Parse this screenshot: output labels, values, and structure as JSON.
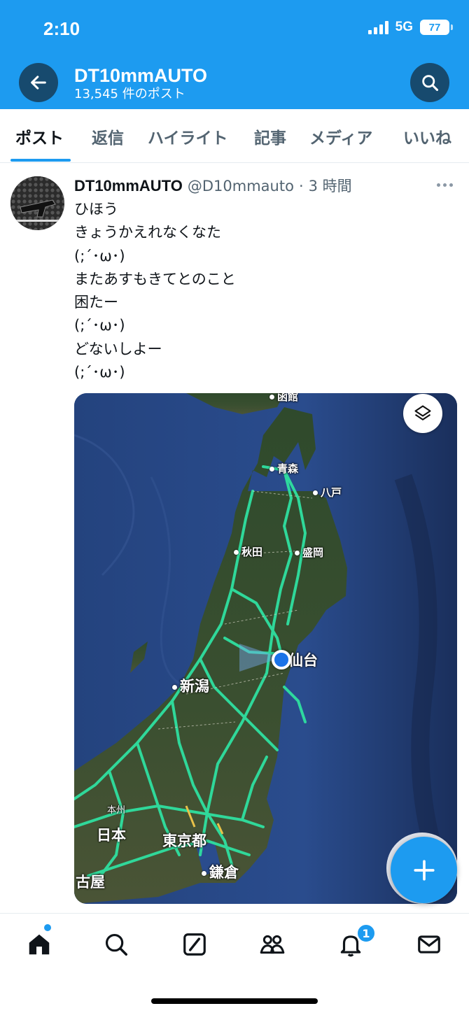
{
  "status_bar": {
    "time": "2:10",
    "network": "5G",
    "battery": "77"
  },
  "header": {
    "title": "DT10mmAUTO",
    "subtitle": "13,545 件のポスト"
  },
  "tabs": [
    {
      "label": "ポスト",
      "active": true
    },
    {
      "label": "返信"
    },
    {
      "label": "ハイライト"
    },
    {
      "label": "記事"
    },
    {
      "label": "メディア"
    },
    {
      "label": "いいね"
    }
  ],
  "post": {
    "name": "DT10mmAUTO",
    "handle": "@D10mmauto",
    "separator": "·",
    "time": "3 時間",
    "lines": [
      "ひほう",
      "きょうかえれなくなた",
      "(;´･ω･)",
      "またあすもきてとのこと",
      "困たー",
      "(;´･ω･)",
      "どないしよー",
      "(;´･ω･)"
    ]
  },
  "map": {
    "labels": {
      "hakodate": "函館",
      "aomori": "青森",
      "hachinohe": "八戸",
      "akita": "秋田",
      "morioka": "盛岡",
      "sendai": "仙台",
      "niigata": "新潟",
      "honshu": "本州",
      "nihon": "日本",
      "tokyo": "東京都",
      "kamakura": "鎌倉",
      "nagoya": "古屋"
    }
  },
  "bottom_nav": {
    "notification_count": "1"
  },
  "colors": {
    "accent": "#1d9bf0",
    "header_button": "#174a6e",
    "road": "#2fe0a0"
  }
}
